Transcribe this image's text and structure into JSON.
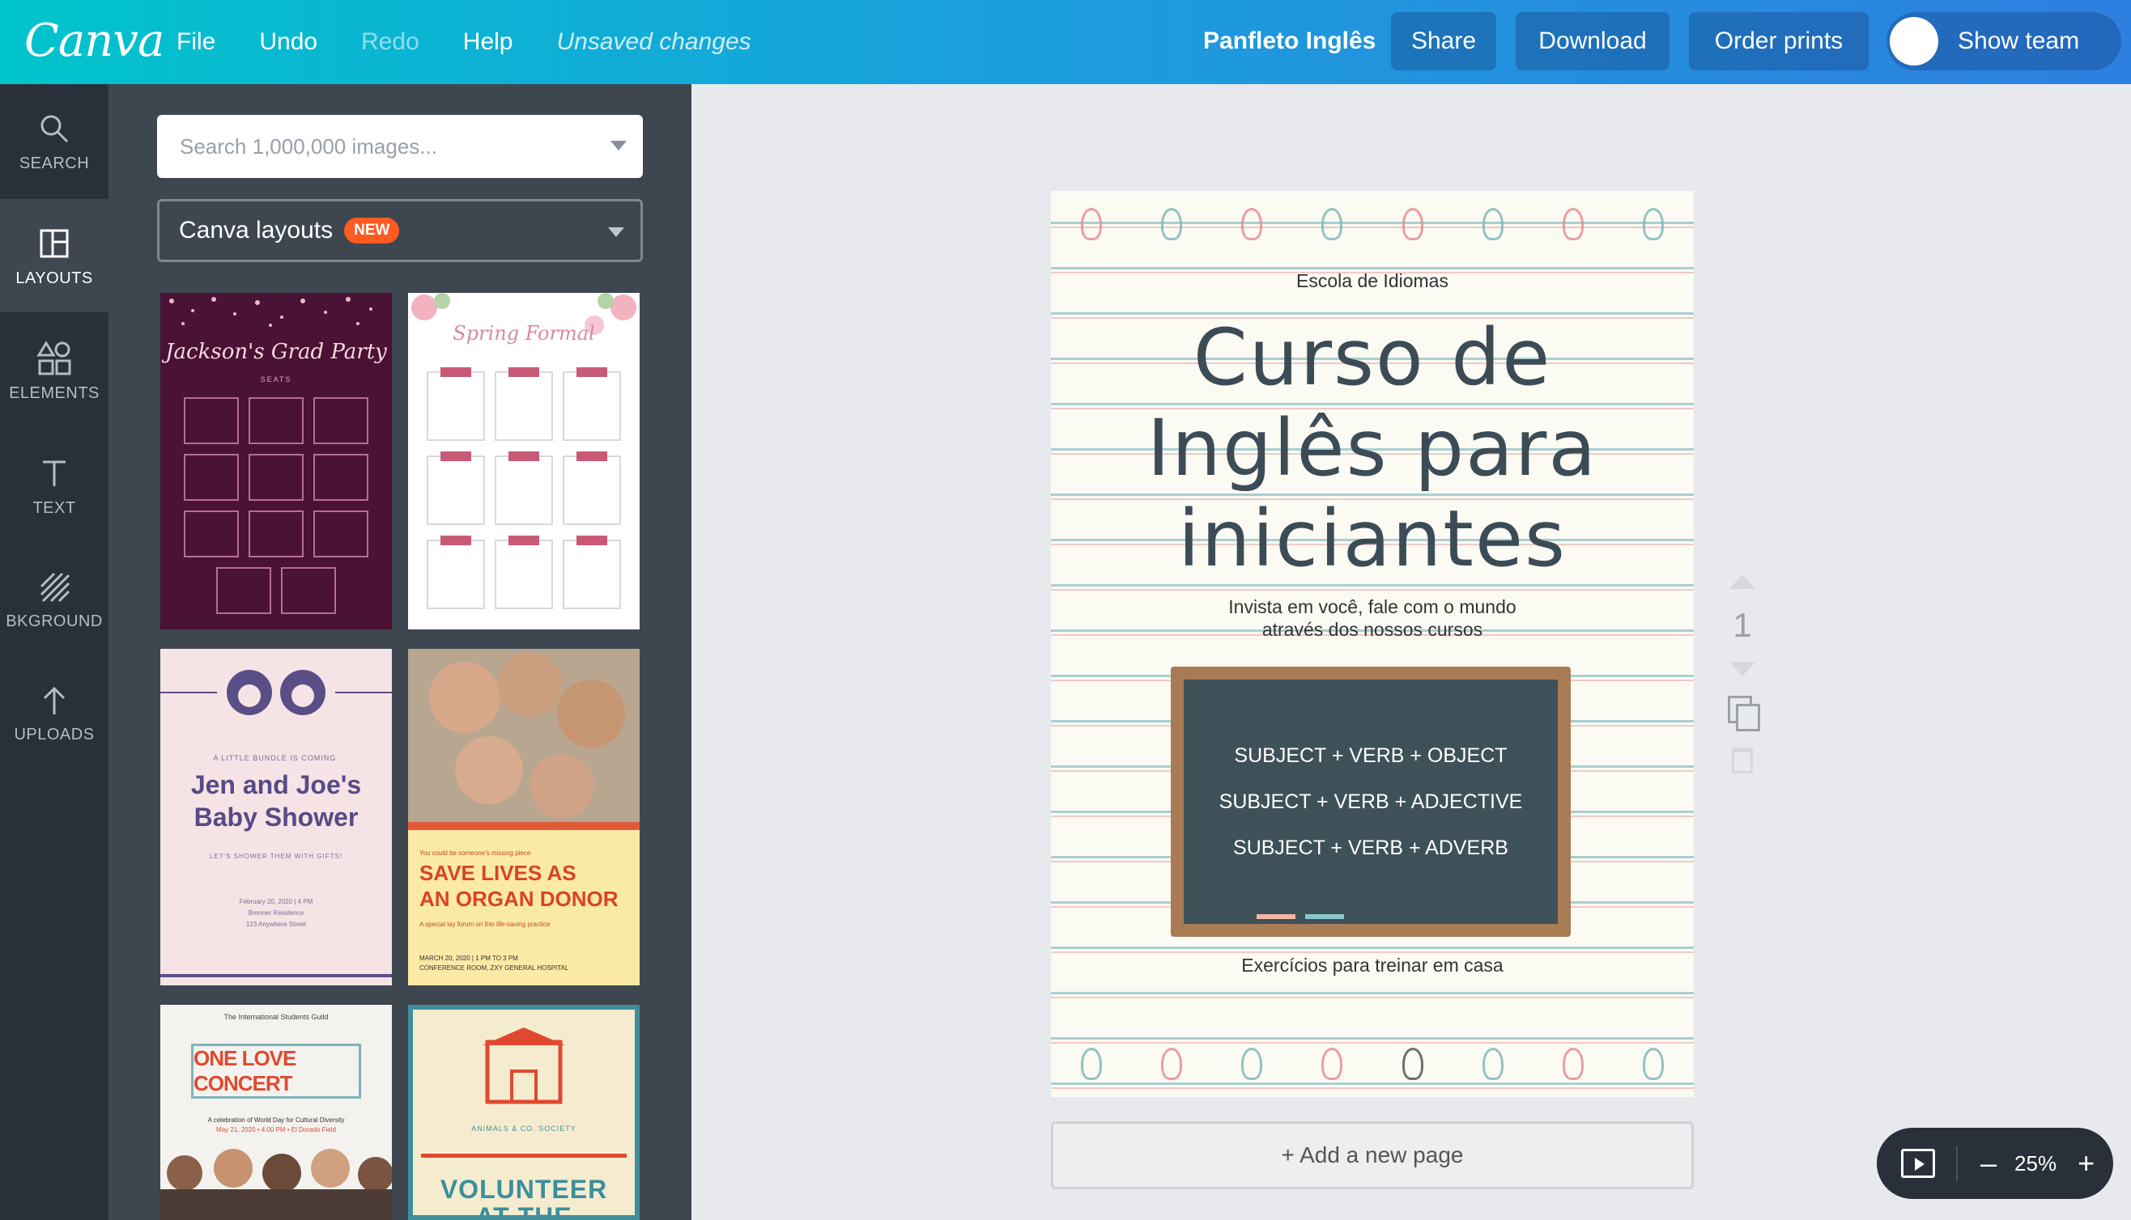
{
  "topbar": {
    "logo": "Canva",
    "menu": {
      "file": "File",
      "undo": "Undo",
      "redo": "Redo",
      "help": "Help",
      "status": "Unsaved changes"
    },
    "doc_title": "Panfleto Inglês",
    "share": "Share",
    "download": "Download",
    "order_prints": "Order prints",
    "show_team": "Show team"
  },
  "rail": [
    {
      "label": "SEARCH",
      "icon": "search-icon"
    },
    {
      "label": "LAYOUTS",
      "icon": "layouts-icon"
    },
    {
      "label": "ELEMENTS",
      "icon": "elements-icon"
    },
    {
      "label": "TEXT",
      "icon": "text-icon"
    },
    {
      "label": "BKGROUND",
      "icon": "background-icon"
    },
    {
      "label": "UPLOADS",
      "icon": "upload-icon"
    }
  ],
  "panel": {
    "search_placeholder": "Search 1,000,000 images...",
    "layout_select": "Canva layouts",
    "new_badge": "NEW",
    "thumbnails": {
      "t1": {
        "title": "Jackson's Grad Party",
        "sub": "SEATS"
      },
      "t2": {
        "title": "Spring Formal"
      },
      "t3": {
        "small": "A LITTLE BUNDLE IS COMING.",
        "title1": "Jen and Joe's",
        "title2": "Baby Shower",
        "tagline": "LET'S SHOWER THEM WITH GIFTS!",
        "date": "February 20, 2020 | 4 PM",
        "place": "Brenner Residence",
        "addr": "123 Anywhere Street"
      },
      "t4": {
        "small": "You could be someone's missing piece",
        "title1": "SAVE LIVES AS",
        "title2": "AN ORGAN DONOR",
        "desc": "A special lay forum on this life-saving practice",
        "when": "MARCH 20, 2020 | 1 PM TO 3 PM",
        "where": "CONFERENCE ROOM, ZXY GENERAL HOSPITAL"
      },
      "t5": {
        "org": "The International Students Guild",
        "title": "ONE LOVE CONCERT",
        "desc": "A celebration of World Day for Cultural Diversity",
        "when": "May 21, 2020 • 4:00 PM • El Dorado Field"
      },
      "t6": {
        "org": "ANIMALS & CO. SOCIETY",
        "title1": "VOLUNTEER",
        "title2": "AT THE"
      }
    }
  },
  "design": {
    "school": "Escola de Idiomas",
    "heading": [
      "Curso de",
      "Inglês para",
      "iniciantes"
    ],
    "sub": [
      "Invista em você, fale com o mundo",
      "através dos nossos cursos"
    ],
    "board": [
      "SUBJECT + VERB + OBJECT",
      "SUBJECT + VERB + ADJECTIVE",
      "SUBJECT + VERB + ADVERB"
    ],
    "exercises": "Exercícios para treinar em casa"
  },
  "canvas": {
    "add_page": "+ Add a new page",
    "page_number": "1"
  },
  "zoom": {
    "minus": "–",
    "value": "25%",
    "plus": "+"
  }
}
